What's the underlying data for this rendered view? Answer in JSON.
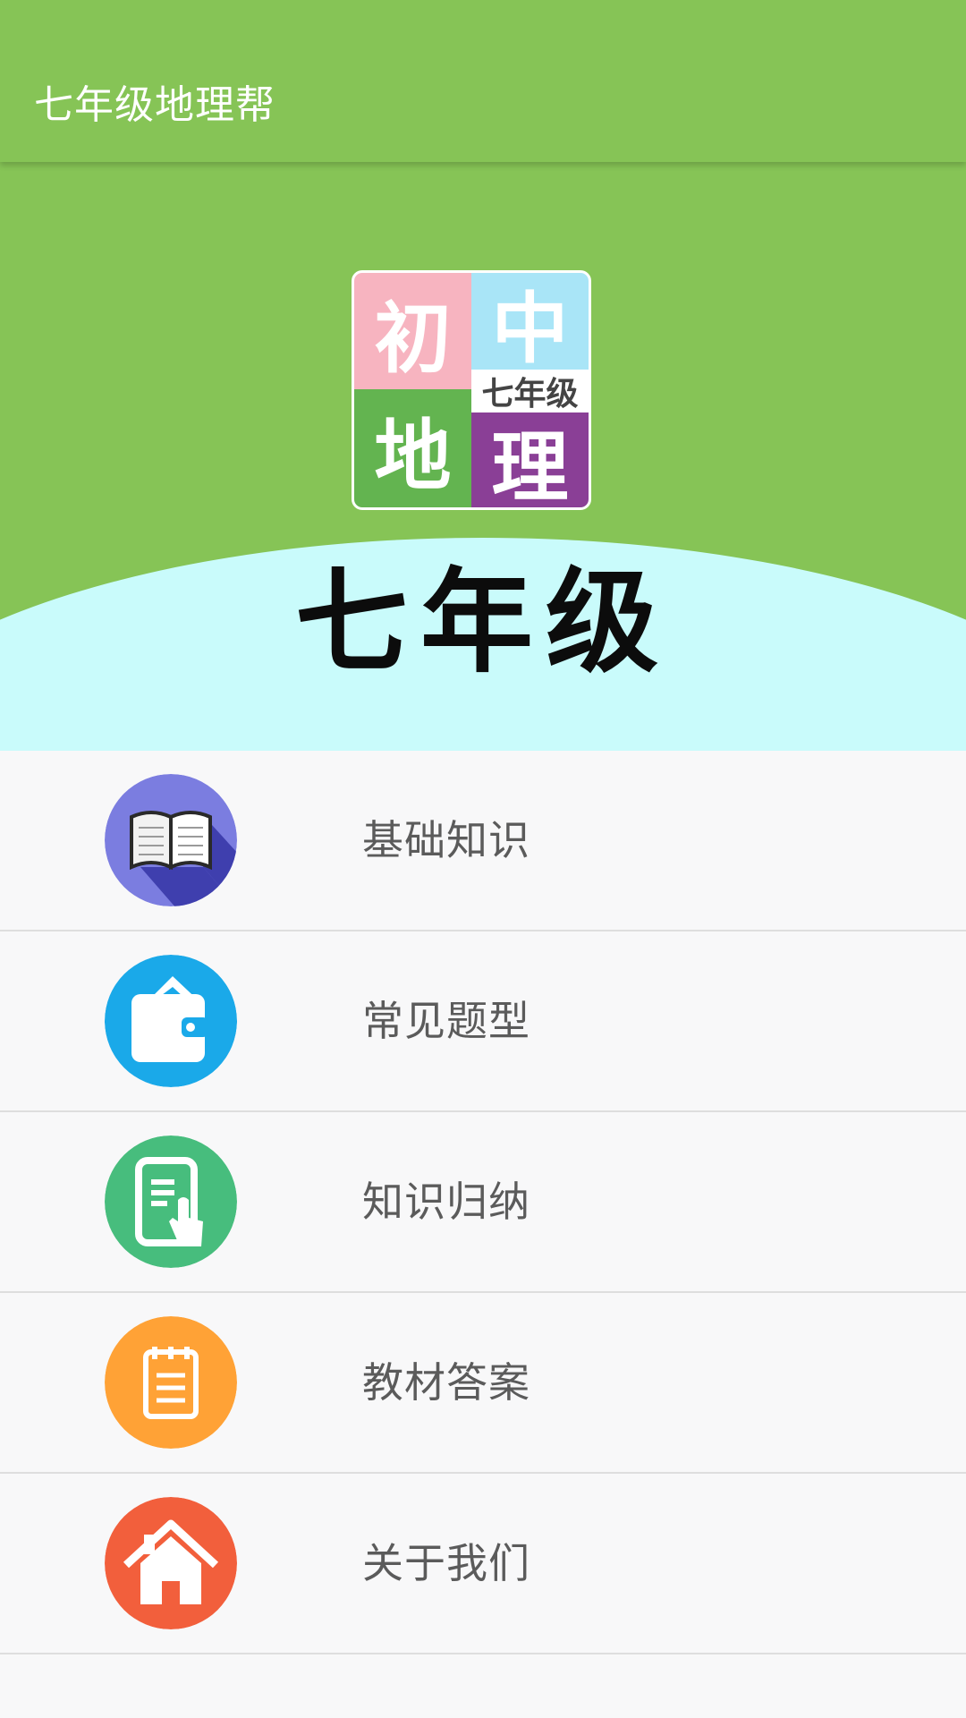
{
  "appbar": {
    "title": "七年级地理帮"
  },
  "banner": {
    "logo": {
      "tl": "初",
      "tr": "中",
      "tr_sub": "七年级",
      "bl": "地",
      "br": "理"
    },
    "big_text": "七年级"
  },
  "menu": {
    "items": [
      {
        "label": "基础知识",
        "icon": "book-icon",
        "color": "#7b7de0"
      },
      {
        "label": "常见题型",
        "icon": "wallet-icon",
        "color": "#1aa9e9"
      },
      {
        "label": "知识归纳",
        "icon": "tablet-touch-icon",
        "color": "#47bd7d"
      },
      {
        "label": "教材答案",
        "icon": "clipboard-icon",
        "color": "#ffa236"
      },
      {
        "label": "关于我们",
        "icon": "home-icon",
        "color": "#f25f3c"
      }
    ]
  }
}
